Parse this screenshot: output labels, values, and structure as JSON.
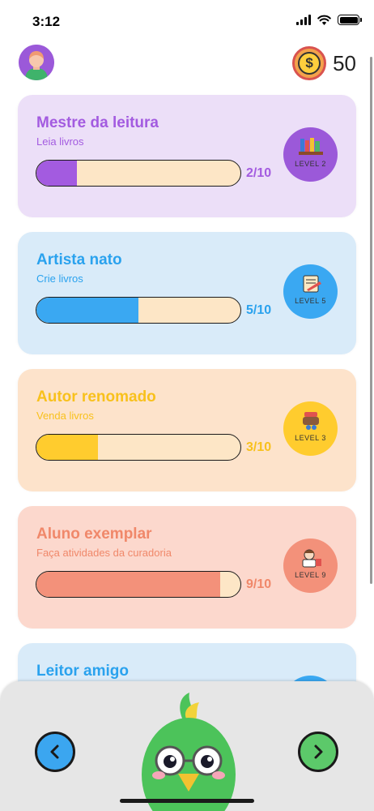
{
  "status_bar": {
    "time": "3:12"
  },
  "header": {
    "coins": "50",
    "coin_symbol": "$"
  },
  "cards": [
    {
      "title": "Mestre da leitura",
      "subtitle": "Leia livros",
      "progress": 0.2,
      "count": "2/10",
      "level": "LEVEL 2",
      "bg": "#ecdff8",
      "title_color": "#a35be0",
      "sub_color": "#a35be0",
      "fill": "#a35be0",
      "badge_bg": "#9b59d9",
      "icon": "bookshelf-icon"
    },
    {
      "title": "Artista nato",
      "subtitle": "Crie livros",
      "progress": 0.5,
      "count": "5/10",
      "level": "LEVEL 5",
      "bg": "#d9ebf9",
      "title_color": "#2aa2ee",
      "sub_color": "#2aa2ee",
      "fill": "#3aa8f2",
      "badge_bg": "#3aa8f2",
      "icon": "scroll-quill-icon"
    },
    {
      "title": "Autor renomado",
      "subtitle": "Venda livros",
      "progress": 0.3,
      "count": "3/10",
      "level": "LEVEL 3",
      "bg": "#fde3cb",
      "title_color": "#f8c11c",
      "sub_color": "#f8c11c",
      "fill": "#ffcc2e",
      "badge_bg": "#ffcc2e",
      "icon": "book-cart-icon"
    },
    {
      "title": "Aluno exemplar",
      "subtitle": "Faça atividades da curadoria",
      "progress": 0.9,
      "count": "9/10",
      "level": "LEVEL 9",
      "bg": "#fcd8cd",
      "title_color": "#f0886a",
      "sub_color": "#f0886a",
      "fill": "#f3917a",
      "badge_bg": "#f3917a",
      "icon": "student-icon"
    },
    {
      "title": "Leitor amigo",
      "subtitle": "",
      "progress": 0,
      "count": "",
      "level": "",
      "bg": "#d9ebf9",
      "title_color": "#2aa2ee",
      "sub_color": "#2aa2ee",
      "fill": "#3aa8f2",
      "badge_bg": "#3aa8f2",
      "icon": "book-icon"
    }
  ],
  "colors": {
    "accent_blue": "#3ba6f0",
    "accent_green": "#5cc96a",
    "panel": "#e6e6e6"
  }
}
